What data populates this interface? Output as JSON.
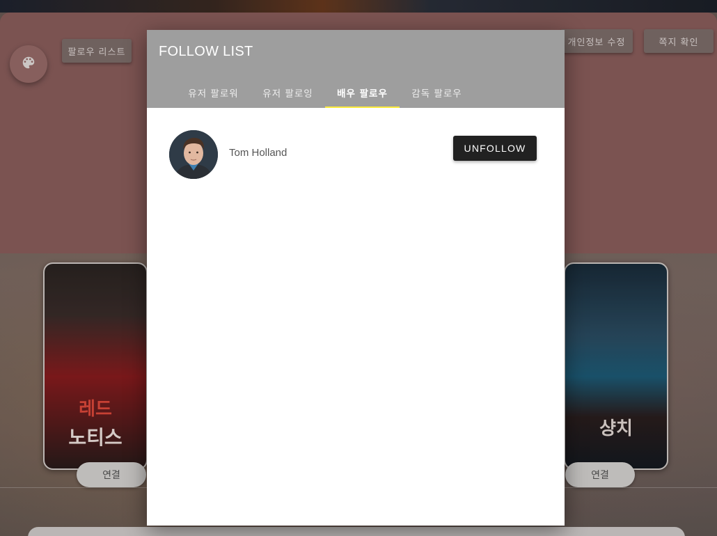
{
  "background": {
    "follow_list_button": "팔로우 리스트",
    "edit_profile_button": "개인정보 수정",
    "messages_button": "쪽지 확인",
    "posters": [
      {
        "title_top": "레드",
        "title_bottom": "노티스",
        "connect_label": "연결"
      },
      {
        "title_top": "샹치",
        "connect_label": "연결"
      }
    ]
  },
  "modal": {
    "title": "FOLLOW LIST",
    "tabs": [
      {
        "label": "유저 팔로워",
        "active": false
      },
      {
        "label": "유저 팔로잉",
        "active": false
      },
      {
        "label": "배우 팔로우",
        "active": true
      },
      {
        "label": "감독 팔로우",
        "active": false
      }
    ],
    "items": [
      {
        "name": "Tom Holland",
        "action_label": "UNFOLLOW"
      }
    ]
  },
  "colors": {
    "accent": "#ffeb3b",
    "header": "#9e9e9e",
    "button_dark": "#212121",
    "panel": "#8c5f5d"
  }
}
